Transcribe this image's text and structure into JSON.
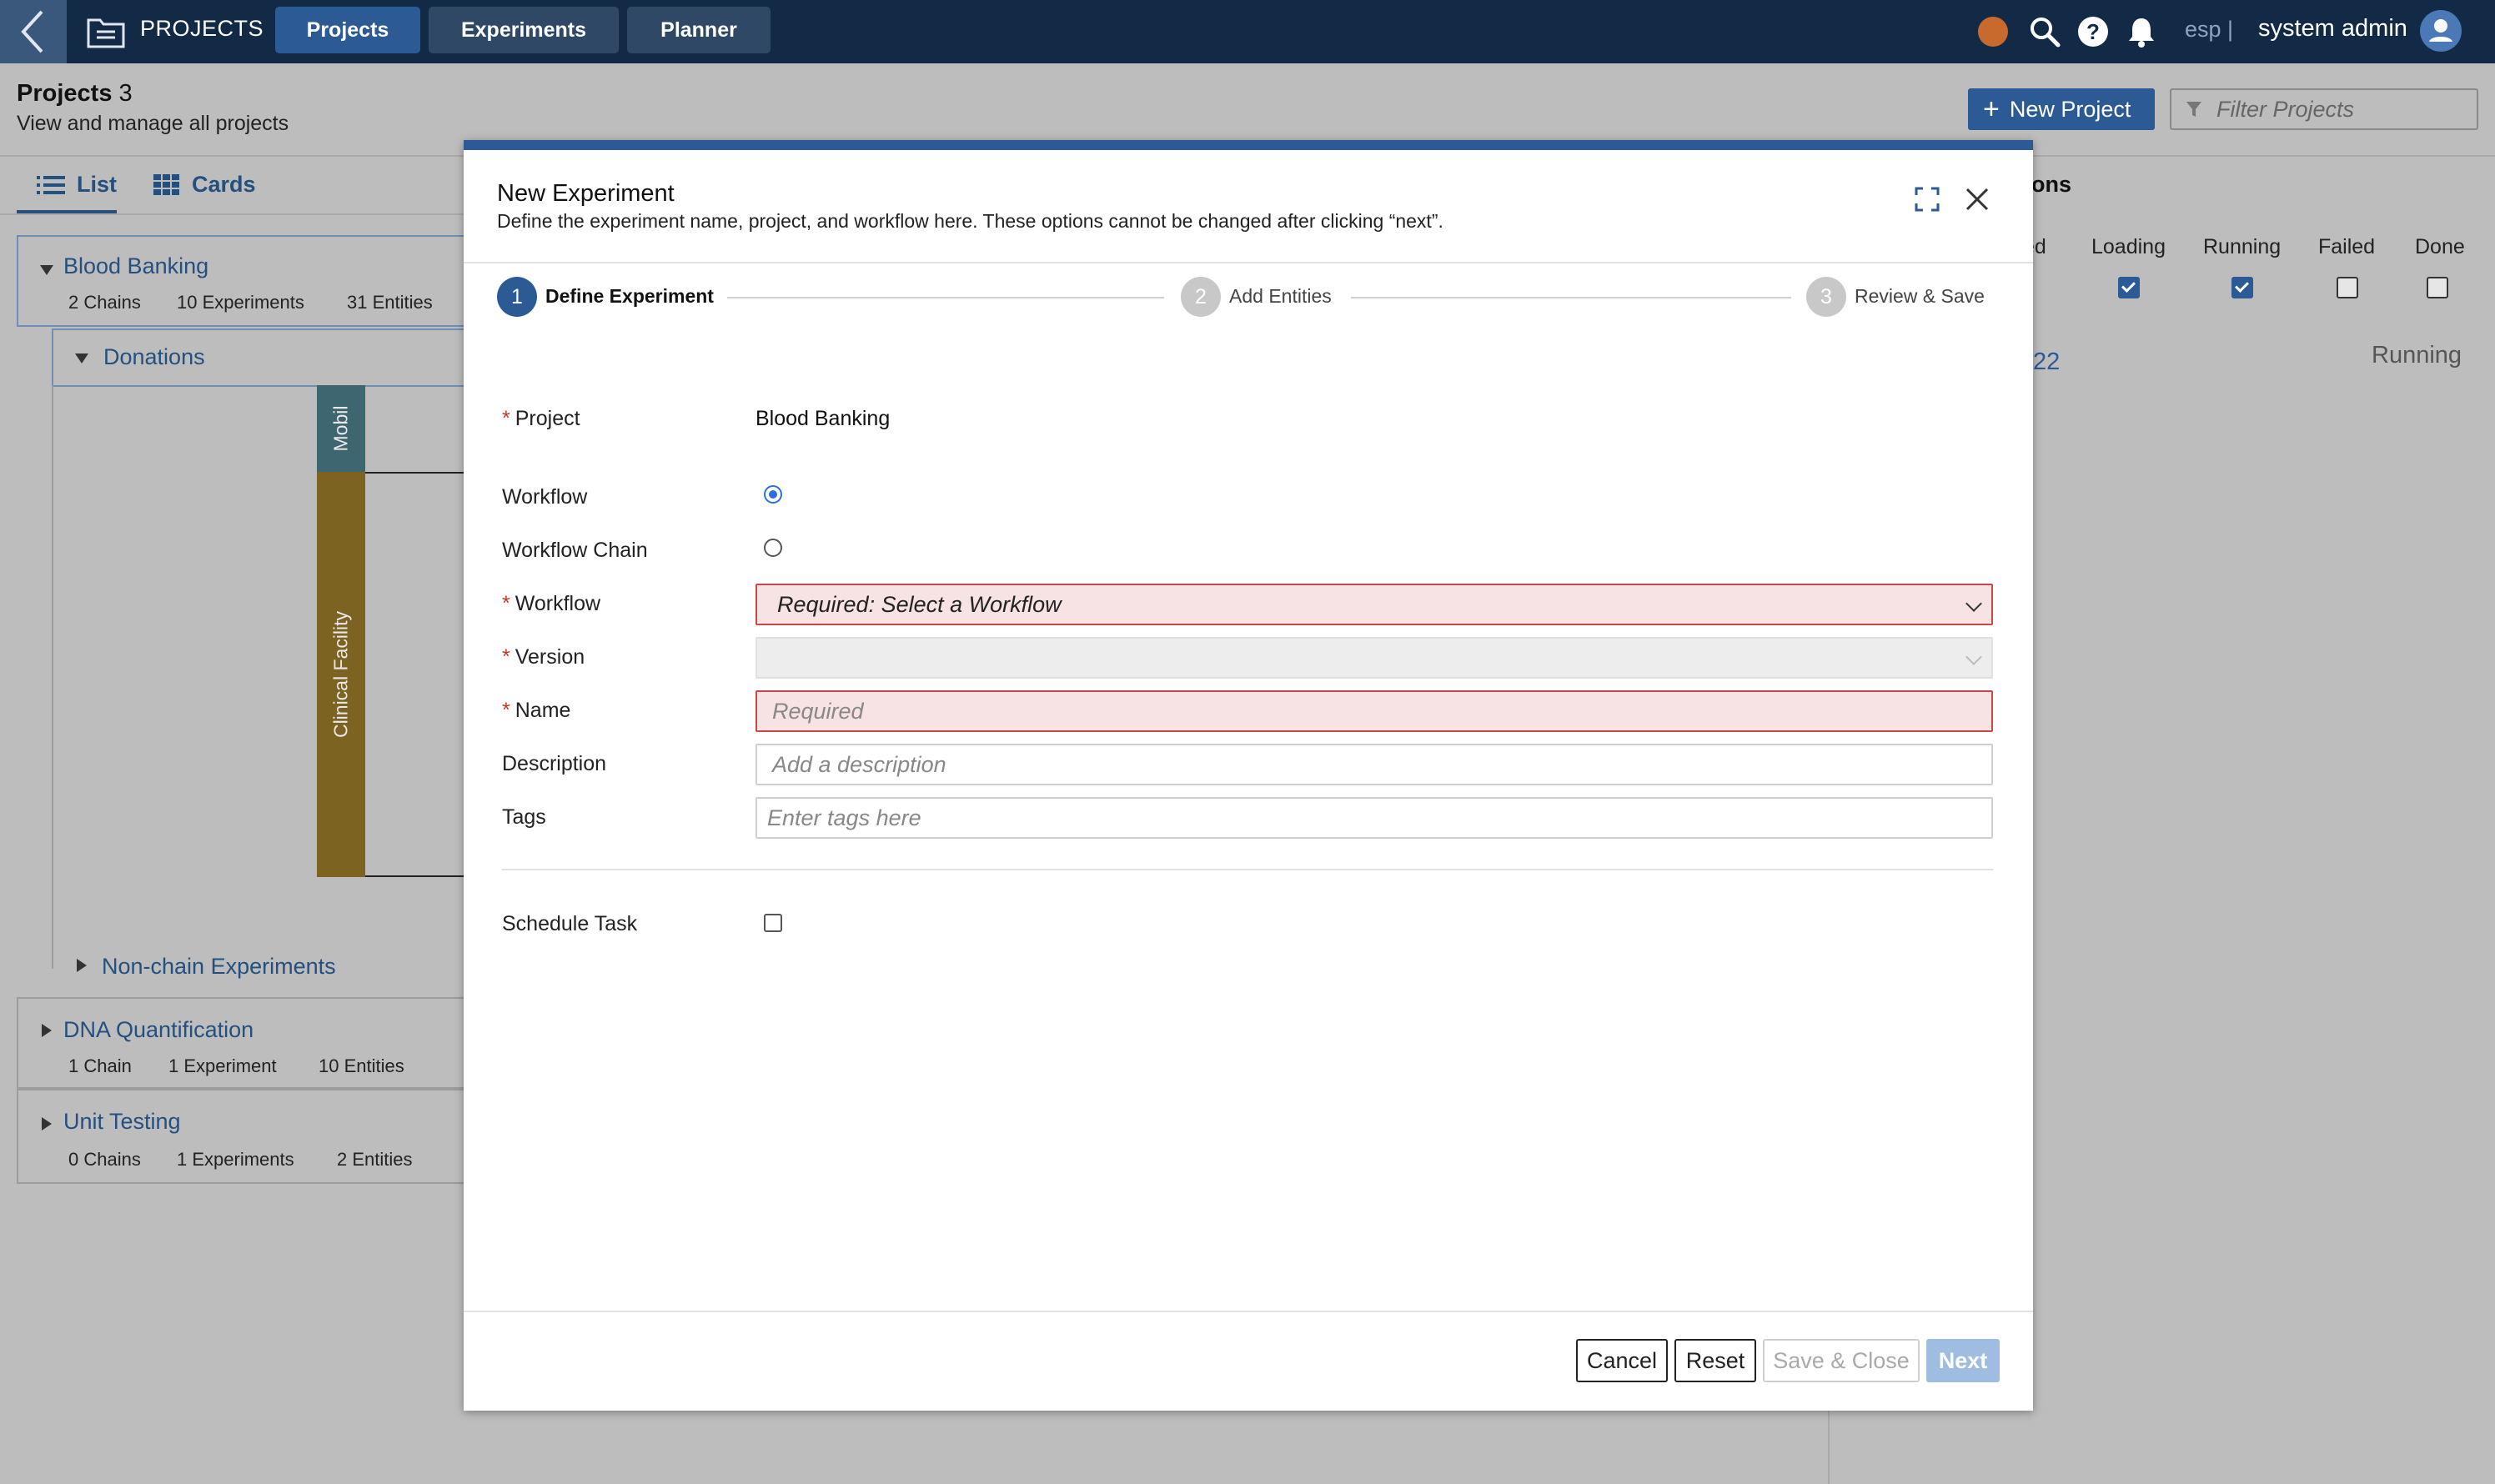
{
  "topbar": {
    "app_title": "PROJECTS",
    "tabs": [
      {
        "label": "Projects",
        "active": true
      },
      {
        "label": "Experiments",
        "active": false
      },
      {
        "label": "Planner",
        "active": false
      }
    ],
    "language": "esp |",
    "user": "system admin",
    "status_color": "#c86a2e"
  },
  "page": {
    "title": "Projects",
    "count": "3",
    "subtitle": "View and manage all projects",
    "new_project_label": "New Project",
    "filter_placeholder": "Filter Projects",
    "view_tabs": [
      {
        "label": "List",
        "active": true
      },
      {
        "label": "Cards",
        "active": false
      }
    ],
    "projects": [
      {
        "name": "Blood Banking",
        "chains": "2 Chains",
        "experiments": "10 Experiments",
        "entities": "31 Entities"
      },
      {
        "name": "DNA Quantification",
        "chains": "1 Chain",
        "experiments": "1 Experiment",
        "entities": "10 Entities"
      },
      {
        "name": "Unit Testing",
        "chains": "0 Chains",
        "experiments": "1 Experiments",
        "entities": "2 Entities"
      }
    ],
    "chain_name": "Donations",
    "lanes": [
      "Mobil",
      "Clinical Facility"
    ],
    "non_chain_label": "Non-chain Experiments",
    "right_panel": {
      "title_fragment": "ons",
      "columns": [
        "ed",
        "Loading",
        "Running",
        "Failed",
        "Done"
      ],
      "checks": [
        true,
        true,
        false,
        false
      ],
      "row_link_fragment": "22",
      "row_status": "Running"
    }
  },
  "modal": {
    "title": "New Experiment",
    "subtitle": "Define the experiment name, project, and workflow here. These options cannot be changed after clicking “next”.",
    "steps": [
      {
        "num": "1",
        "label": "Define Experiment",
        "active": true
      },
      {
        "num": "2",
        "label": "Add Entities",
        "active": false
      },
      {
        "num": "3",
        "label": "Review & Save",
        "active": false
      }
    ],
    "fields": {
      "project_label": "Project",
      "project_value": "Blood Banking",
      "workflow_radio_label": "Workflow",
      "workflow_chain_radio_label": "Workflow Chain",
      "workflow_label": "Workflow",
      "workflow_value": "Required: Select a Workflow",
      "version_label": "Version",
      "name_label": "Name",
      "name_placeholder": "Required",
      "description_label": "Description",
      "description_placeholder": "Add a description",
      "tags_label": "Tags",
      "tags_placeholder": "Enter tags here",
      "schedule_label": "Schedule Task"
    },
    "buttons": {
      "cancel": "Cancel",
      "reset": "Reset",
      "save_close": "Save & Close",
      "next": "Next"
    },
    "accent_color": "#2c5a94",
    "error_color": "#c74848"
  }
}
